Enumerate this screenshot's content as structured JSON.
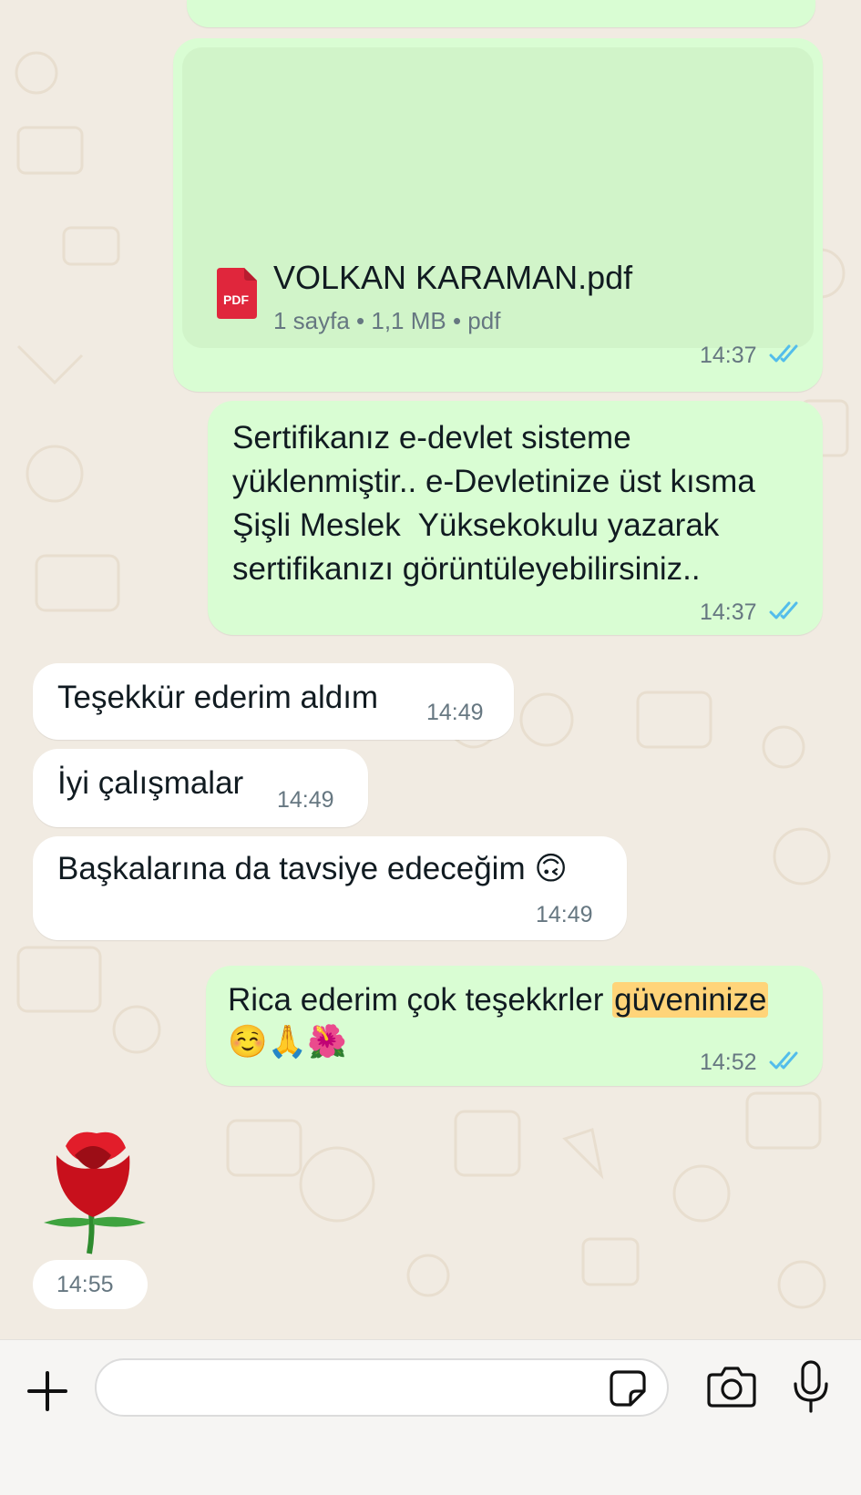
{
  "colors": {
    "outgoing_bubble": "#d9fdd3",
    "incoming_bubble": "#ffffff",
    "read_ticks": "#53bdeb",
    "pdf_red": "#e0263c",
    "highlight": "#ffd479",
    "background": "#f1ebe2"
  },
  "messages": {
    "pdf": {
      "file_name": "VOLKAN KARAMAN.pdf",
      "icon_label": "PDF",
      "meta": "1 sayfa • 1,1 MB • pdf",
      "time": "14:37",
      "status_icon": "double-check-icon"
    },
    "certificate": {
      "lines": [
        "Sertifikanız e-devlet sisteme",
        "yüklenmiştir.. e-Devletinize üst kısma",
        "Şişli Meslek  Yüksekokulu yazarak",
        "sertifikanızı görüntüleyebilirsiniz.."
      ],
      "time": "14:37",
      "status_icon": "double-check-icon"
    },
    "thanks": {
      "text": "Teşekkür ederim aldım",
      "time": "14:49"
    },
    "iyi": {
      "text": "İyi çalışmalar",
      "time": "14:49"
    },
    "baska": {
      "text": "Başkalarına da tavsiye edeceğim 🙃",
      "time": "14:49"
    },
    "rica": {
      "text_before": "Rica ederim çok teşekkrler ",
      "text_highlight": "güveninize",
      "emojis": "☺️🙏🌺",
      "time": "14:52",
      "status_icon": "double-check-icon"
    },
    "rose": {
      "emoji_icon": "rose-icon",
      "time": "14:55"
    }
  },
  "composer": {
    "input_value": "",
    "input_placeholder": "",
    "icons": [
      "plus-icon",
      "sticker-icon",
      "camera-icon",
      "microphone-icon"
    ]
  }
}
